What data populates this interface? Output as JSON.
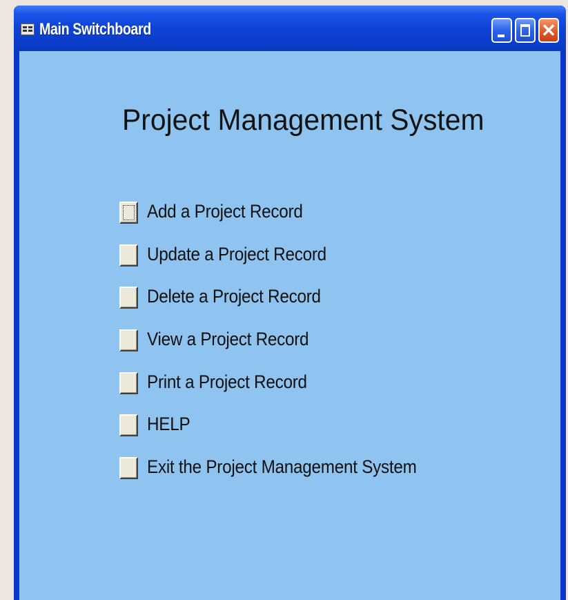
{
  "window": {
    "title": "Main Switchboard",
    "minimize_icon": "minimize-icon",
    "maximize_icon": "maximize-icon",
    "close_icon": "close-icon",
    "close_glyph": "✕",
    "colors": {
      "titlebar": "#0b3ecb",
      "client_bg": "#8ec4ef",
      "close_button": "#e05a26"
    }
  },
  "form": {
    "heading": "Project Management System",
    "items": [
      {
        "label": "Add a Project Record",
        "focused": true
      },
      {
        "label": "Update a Project Record",
        "focused": false
      },
      {
        "label": "Delete a Project Record",
        "focused": false
      },
      {
        "label": "View a Project Record",
        "focused": false
      },
      {
        "label": "Print a Project Record",
        "focused": false
      },
      {
        "label": "HELP",
        "focused": false
      },
      {
        "label": "Exit the Project Management System",
        "focused": false
      }
    ]
  }
}
